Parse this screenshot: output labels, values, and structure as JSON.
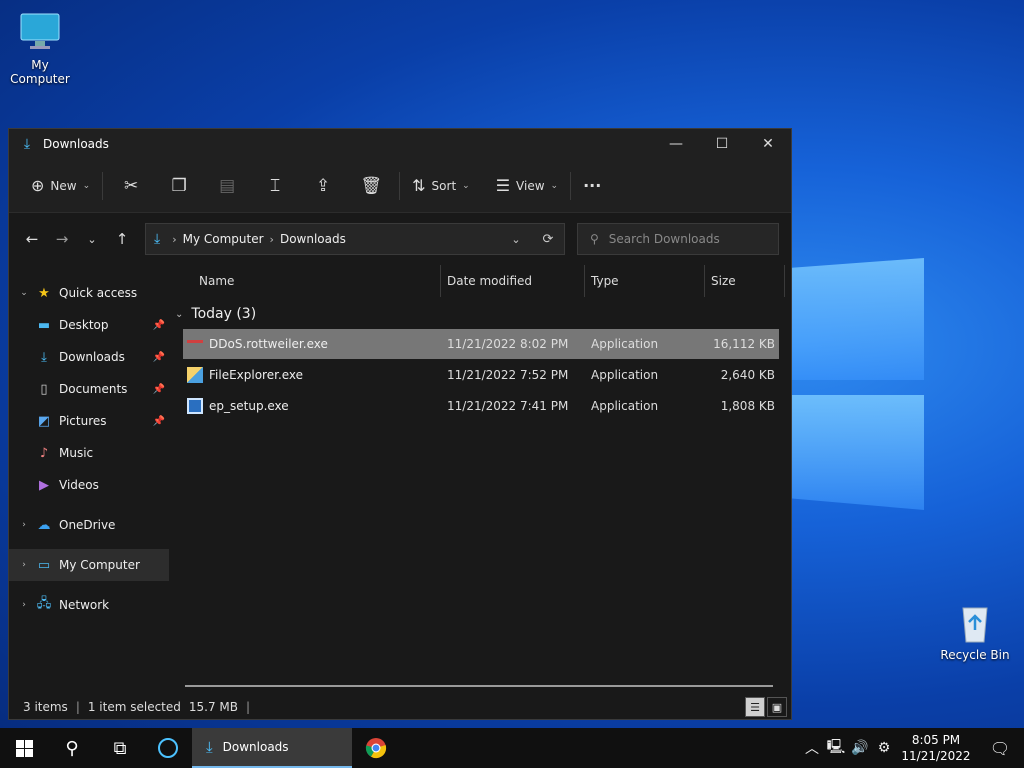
{
  "desktop": {
    "icons": [
      {
        "label": "My Computer",
        "icon": "monitor-icon"
      },
      {
        "label": "Recycle Bin",
        "icon": "recycle-bin-icon"
      }
    ]
  },
  "window": {
    "title": "Downloads",
    "controls": {
      "minimize": "—",
      "maximize": "☐",
      "close": "✕"
    }
  },
  "toolbar": {
    "new_label": "New",
    "sort_label": "Sort",
    "view_label": "View",
    "more_label": "···"
  },
  "address": {
    "crumbs": [
      "My Computer",
      "Downloads"
    ]
  },
  "search": {
    "placeholder": "Search Downloads"
  },
  "sidebar": {
    "quick_access": "Quick access",
    "items": [
      {
        "label": "Desktop",
        "pinned": true
      },
      {
        "label": "Downloads",
        "pinned": true
      },
      {
        "label": "Documents",
        "pinned": true
      },
      {
        "label": "Pictures",
        "pinned": true
      },
      {
        "label": "Music",
        "pinned": false
      },
      {
        "label": "Videos",
        "pinned": false
      }
    ],
    "onedrive": "OneDrive",
    "my_computer": "My Computer",
    "network": "Network"
  },
  "columns": {
    "name": "Name",
    "date": "Date modified",
    "type": "Type",
    "size": "Size"
  },
  "group": {
    "label": "Today (3)"
  },
  "files": [
    {
      "name": "DDoS.rottweiler.exe",
      "date": "11/21/2022 8:02 PM",
      "type": "Application",
      "size": "16,112 KB",
      "selected": true,
      "icon": "ddos-exe-icon"
    },
    {
      "name": "FileExplorer.exe",
      "date": "11/21/2022 7:52 PM",
      "type": "Application",
      "size": "2,640 KB",
      "selected": false,
      "icon": "file-explorer-exe-icon"
    },
    {
      "name": "ep_setup.exe",
      "date": "11/21/2022 7:41 PM",
      "type": "Application",
      "size": "1,808 KB",
      "selected": false,
      "icon": "setup-exe-icon"
    }
  ],
  "status": {
    "items": "3 items",
    "selected": "1 item selected",
    "size": "15.7 MB"
  },
  "taskbar": {
    "app_label": "Downloads",
    "time": "8:05 PM",
    "date": "11/21/2022"
  },
  "colors": {
    "accent": "#4cc2ff",
    "selected_row": "#777777"
  }
}
